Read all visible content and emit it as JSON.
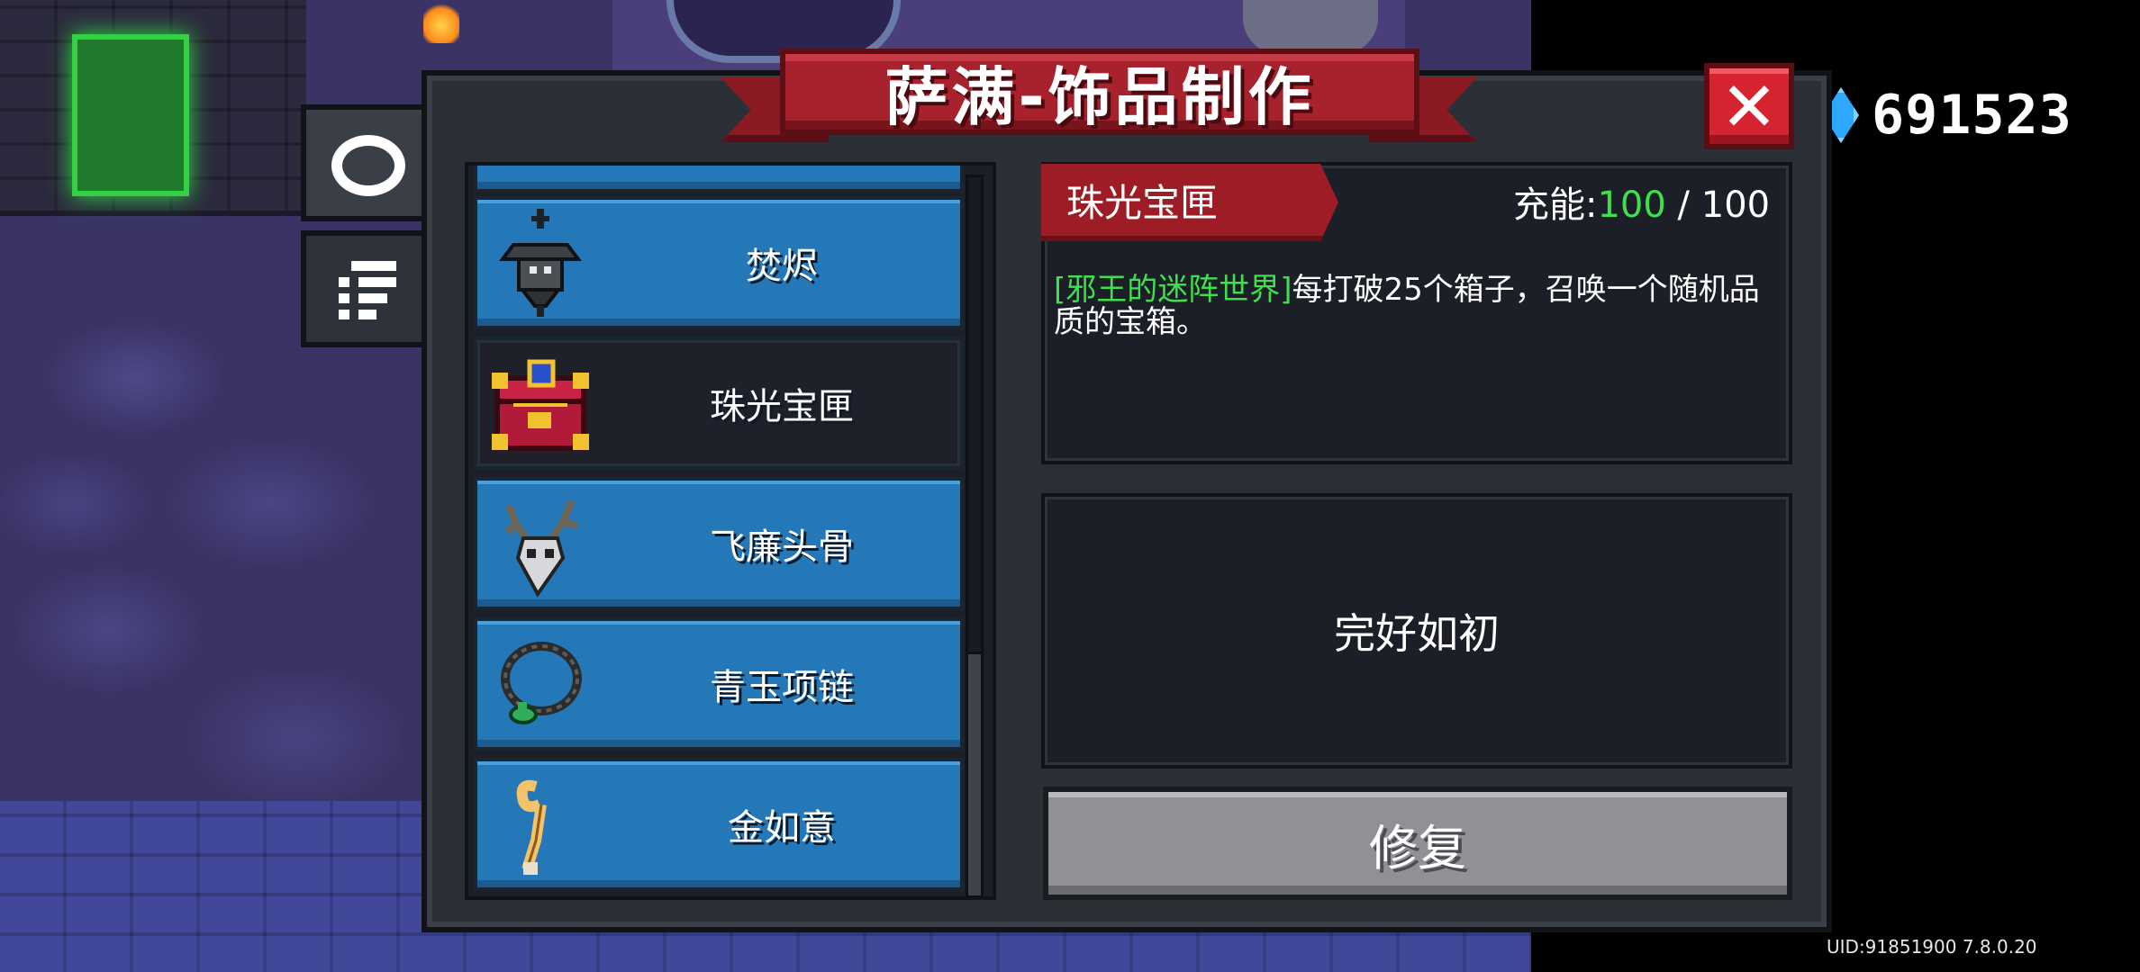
{
  "title": "萨满-饰品制作",
  "currency": {
    "icon": "gem-icon",
    "value": "691523"
  },
  "uid_text": "UID:91851900 7.8.0.20",
  "side_tabs": [
    {
      "name": "accessory-tab",
      "icon": "ring-icon",
      "active": true
    },
    {
      "name": "list-tab",
      "icon": "list-icon",
      "active": false
    }
  ],
  "list_items": [
    {
      "label": "",
      "icon": "partial-item-icon",
      "selected": false
    },
    {
      "label": "焚烬",
      "icon": "lantern-icon",
      "selected": false
    },
    {
      "label": "珠光宝匣",
      "icon": "treasure-chest-icon",
      "selected": true
    },
    {
      "label": "飞廉头骨",
      "icon": "antler-skull-icon",
      "selected": false
    },
    {
      "label": "青玉项链",
      "icon": "jade-necklace-icon",
      "selected": false
    },
    {
      "label": "金如意",
      "icon": "golden-ruyi-icon",
      "selected": false
    }
  ],
  "detail": {
    "name": "珠光宝匣",
    "charge_label": "充能:",
    "charge_current": "100",
    "charge_separator": " / ",
    "charge_max": "100",
    "desc_highlight": "[邪王的迷阵世界]",
    "desc_text": "每打破25个箱子，召唤一个随机品质的宝箱。",
    "status": "完好如初",
    "repair_label": "修复"
  },
  "colors": {
    "accent_green": "#3ee04c",
    "ribbon_red": "#a8222d",
    "item_blue": "#2478b8",
    "close_red": "#d5232f"
  }
}
